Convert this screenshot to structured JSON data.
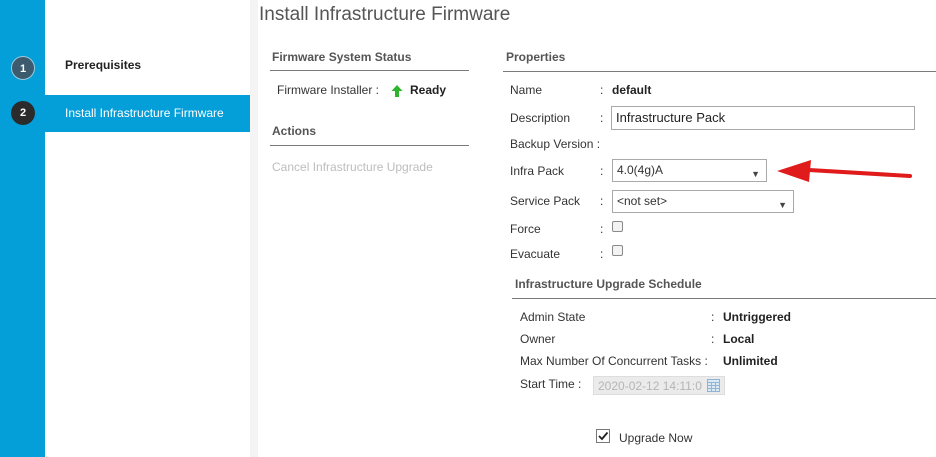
{
  "wizard": {
    "steps": [
      {
        "number": "1",
        "label": "Prerequisites"
      },
      {
        "number": "2",
        "label": "Install Infrastructure Firmware"
      }
    ]
  },
  "page": {
    "title": "Install Infrastructure Firmware"
  },
  "firmware_status": {
    "heading": "Firmware System Status",
    "installer_label": "Firmware Installer :",
    "installer_value": "Ready"
  },
  "actions": {
    "heading": "Actions",
    "cancel_label": "Cancel Infrastructure Upgrade"
  },
  "properties": {
    "heading": "Properties",
    "name_label": "Name",
    "name_value": "default",
    "description_label": "Description",
    "description_value": "Infrastructure Pack",
    "backup_label": "Backup Version :",
    "infra_pack_label": "Infra Pack",
    "infra_pack_value": "4.0(4g)A",
    "service_pack_label": "Service Pack",
    "service_pack_value": "<not set>",
    "force_label": "Force",
    "evacuate_label": "Evacuate",
    "colon": ":"
  },
  "schedule": {
    "heading": "Infrastructure Upgrade Schedule",
    "admin_state_label": "Admin State",
    "admin_state_value": "Untriggered",
    "owner_label": "Owner",
    "owner_value": "Local",
    "max_tasks_label": "Max Number Of Concurrent Tasks :",
    "max_tasks_value": "Unlimited",
    "start_time_label": "Start Time :",
    "start_time_value": "2020-02-12 14:11:0",
    "upgrade_now_label": "Upgrade Now",
    "upgrade_now_checked": true
  },
  "colors": {
    "rail": "#049fd9",
    "selected_step": "#049fd9",
    "ready_arrow": "#2db52d",
    "annotation_arrow": "#e01b1b"
  },
  "icons": [
    "up-arrow-icon",
    "chevron-down-icon",
    "calendar-icon",
    "checkmark-icon",
    "red-pointer-arrow"
  ]
}
